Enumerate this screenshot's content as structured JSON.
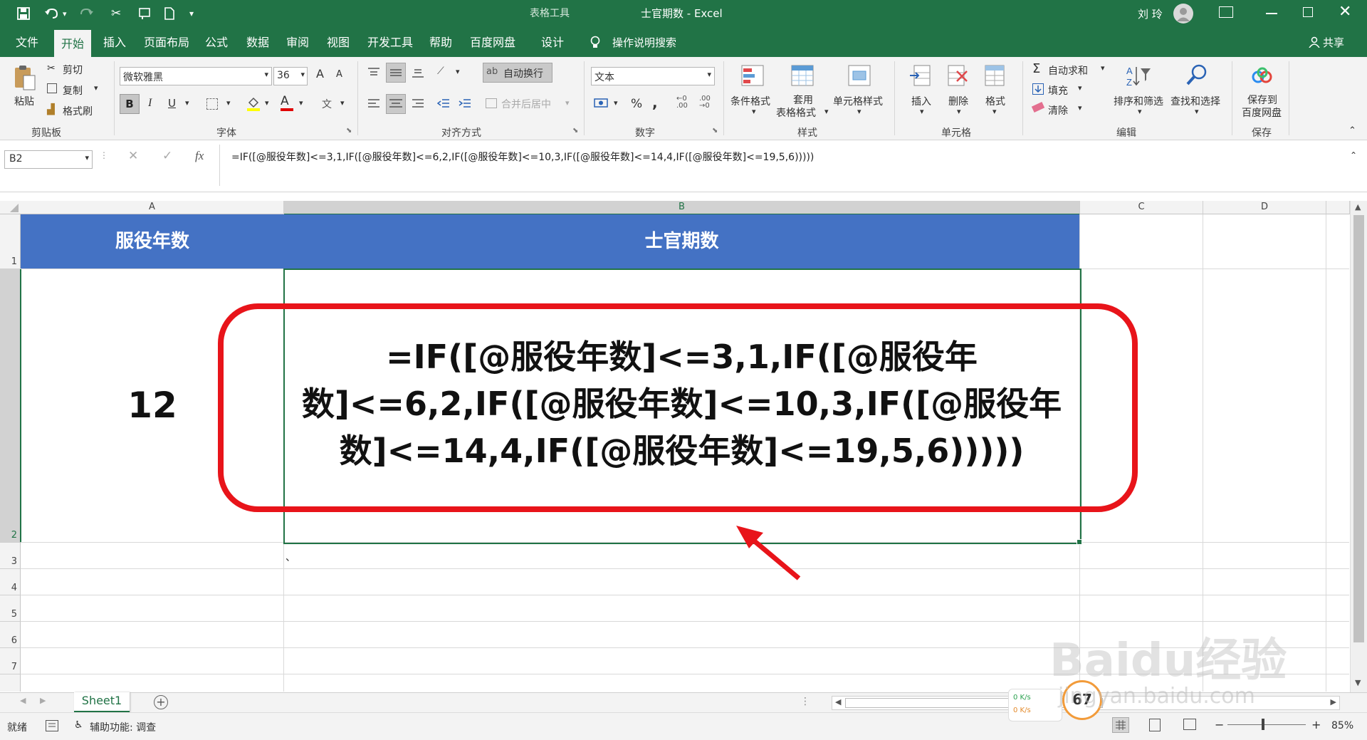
{
  "window": {
    "title": "士官期数 - Excel",
    "context_tab": "表格工具",
    "user": "刘 玲"
  },
  "ribbon_tabs": [
    "文件",
    "开始",
    "插入",
    "页面布局",
    "公式",
    "数据",
    "审阅",
    "视图",
    "开发工具",
    "帮助",
    "百度网盘",
    "设计"
  ],
  "tell_me": "操作说明搜索",
  "share": "共享",
  "clipboard": {
    "paste": "粘贴",
    "cut": "剪切",
    "copy": "复制",
    "format_painter": "格式刷",
    "group": "剪贴板"
  },
  "font": {
    "name": "微软雅黑",
    "size": "36",
    "bold": "B",
    "italic": "I",
    "underline": "U",
    "group": "字体",
    "color_letter": "A",
    "grow": "A",
    "shrink": "A"
  },
  "alignment": {
    "wrap": "自动换行",
    "merge": "合并后居中",
    "group": "对齐方式"
  },
  "number": {
    "format": "文本",
    "group": "数字",
    "percent": "%",
    "comma": ","
  },
  "styles": {
    "conditional": "条件格式",
    "table_format_1": "套用",
    "table_format_2": "表格格式",
    "cell_styles": "单元格样式",
    "group": "样式"
  },
  "cells": {
    "insert": "插入",
    "delete": "删除",
    "format": "格式",
    "group": "单元格"
  },
  "editing": {
    "autosum": "自动求和",
    "fill": "填充",
    "clear": "清除",
    "sort": "排序和筛选",
    "find": "查找和选择",
    "group": "编辑"
  },
  "save": {
    "save_1": "保存到",
    "save_2": "百度网盘",
    "group": "保存"
  },
  "formula_bar": {
    "name_box": "B2",
    "fx": "fx",
    "formula": "=IF([@服役年数]<=3,1,IF([@服役年数]<=6,2,IF([@服役年数]<=10,3,IF([@服役年数]<=14,4,IF([@服役年数]<=19,5,6)))))"
  },
  "grid": {
    "columns": [
      "A",
      "B",
      "C",
      "D"
    ],
    "rows": [
      "1",
      "2",
      "3",
      "4",
      "5",
      "6",
      "7"
    ],
    "header_a": "服役年数",
    "header_b": "士官期数",
    "a2": "12",
    "b2_line1": "=IF([@服役年数]<=3,1,IF([@服役年",
    "b2_line2": "数]<=6,2,IF([@服役年数]<=10,3,IF([@服役年",
    "b2_line3": "数]<=14,4,IF([@服役年数]<=19,5,6)))))",
    "b3": "、",
    "header_color": "#4472c4",
    "annotation_color": "#e8141a"
  },
  "sheet_tab": "Sheet1",
  "status": {
    "ready": "就绪",
    "accessibility": "辅助功能: 调查",
    "zoom": "85%",
    "upload": "0 K/s",
    "download": "0 K/s",
    "speed_badge": "67"
  },
  "watermark": {
    "logo": "Baidu经验",
    "url": "jingyan.baidu.com"
  }
}
